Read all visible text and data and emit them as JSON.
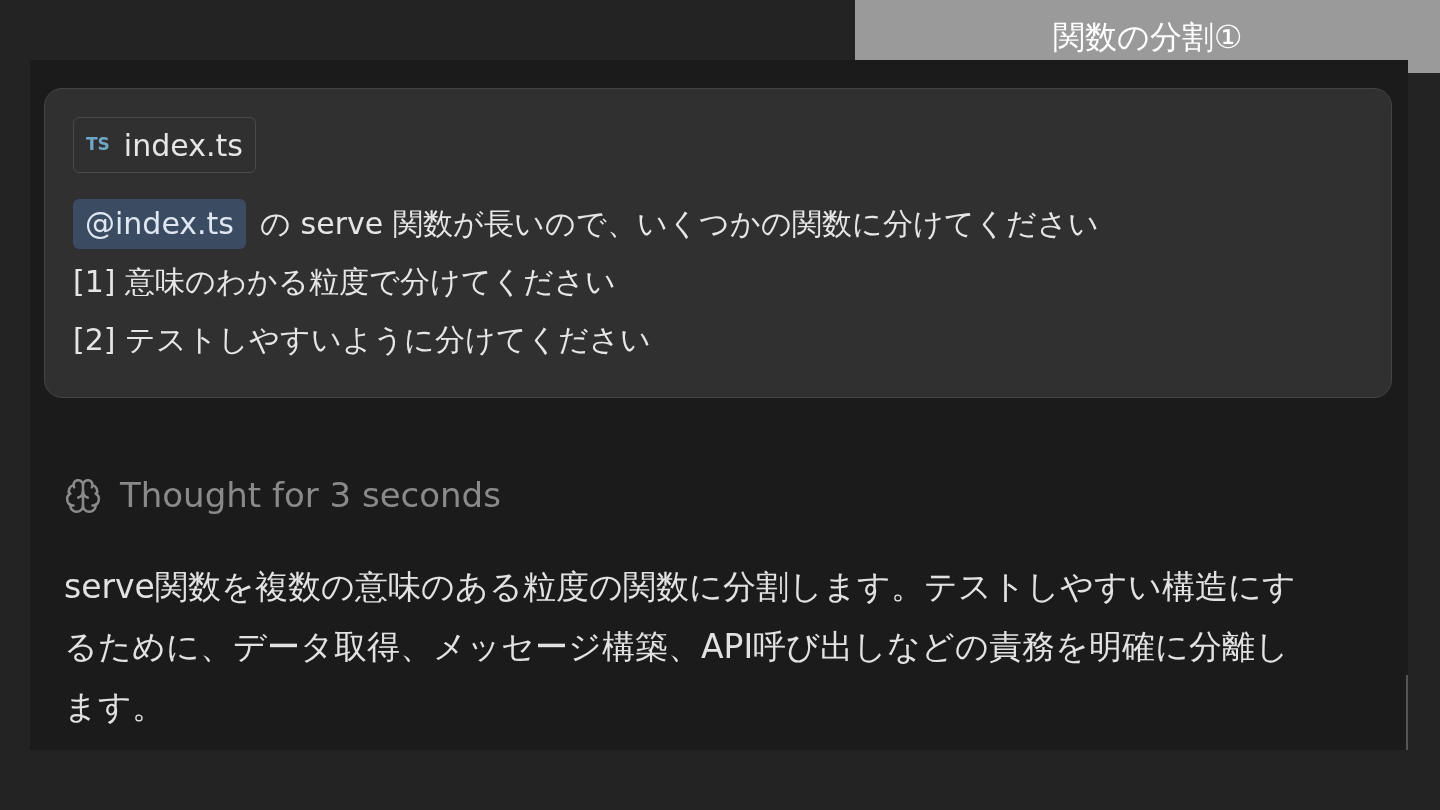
{
  "slide_title": "関数の分割①",
  "message": {
    "attachment": {
      "type_badge": "TS",
      "filename": "index.ts"
    },
    "mention": "@index.ts",
    "first_line": "の serve 関数が長いので、いくつかの関数に分けてください",
    "lines": [
      "[1] 意味のわかる粒度で分けてください",
      "[2] テストしやすいように分けてください"
    ]
  },
  "thought": "Thought for 3 seconds",
  "response": "serve関数を複数の意味のある粒度の関数に分割します。テストしやすい構造にするために、データ取得、メッセージ構築、API呼び出しなどの責務を明確に分離します。"
}
